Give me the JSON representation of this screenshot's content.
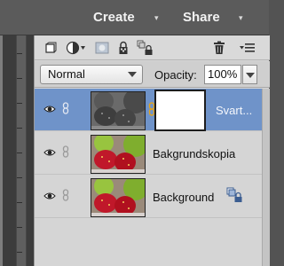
{
  "header": {
    "create_label": "Create",
    "share_label": "Share",
    "caret": "▾"
  },
  "toolbar": {
    "icons": [
      "new-layer-icon",
      "adjustment-layer-icon",
      "layer-mask-icon",
      "lock-transparency-icon",
      "lock-all-icon",
      "trash-icon",
      "panel-menu-icon"
    ]
  },
  "options": {
    "blend_mode": "Normal",
    "opacity_label": "Opacity:",
    "opacity_value": "100%"
  },
  "layers": [
    {
      "name": "Svart...",
      "selected": true,
      "thumb": "grayscale",
      "has_mask": true
    },
    {
      "name": "Bakgrundskopia",
      "selected": false,
      "thumb": "color",
      "has_mask": false
    },
    {
      "name": "Background",
      "selected": false,
      "thumb": "color",
      "has_mask": false,
      "locked": true
    }
  ],
  "colors": {
    "selection": "#6f93c9",
    "panel": "#d5d5d5",
    "header": "#5b5b5b"
  }
}
